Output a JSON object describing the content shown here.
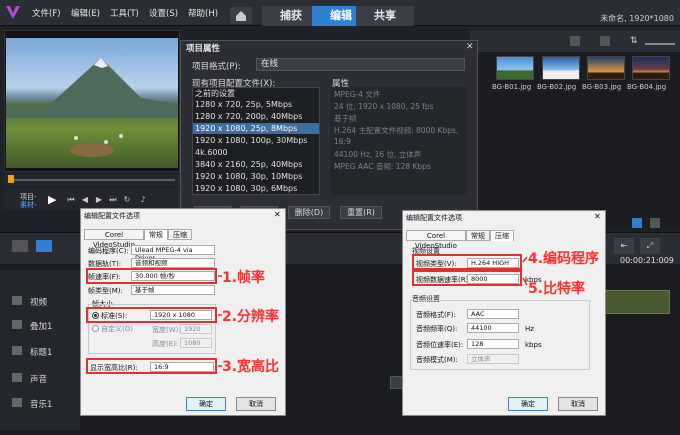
{
  "menu": [
    "文件(F)",
    "编辑(E)",
    "工具(T)",
    "设置(S)",
    "帮助(H)"
  ],
  "tabs": [
    "捕获",
    "编辑",
    "共享"
  ],
  "project_name": "未命名, 1920*1080",
  "player": {
    "label_project": "项目-",
    "label_clip": "素材-"
  },
  "library": {
    "thumbs": [
      "BG-B01.jpg",
      "BG-B02.jpg",
      "BG-B03.jpg",
      "BG-B04.jpg"
    ]
  },
  "timeline": {
    "timecode": "00:00:21:009",
    "tracks": [
      "视频",
      "叠加1",
      "标题1",
      "声音",
      "音乐1"
    ]
  },
  "project_dialog": {
    "title": "项目属性",
    "format_label": "项目格式(P):",
    "format_value": "在线",
    "profiles_label": "现有项目配置文件(X):",
    "props_label": "属性",
    "profiles": [
      "之前的设置",
      "1280 x 720, 25p, 5Mbps",
      "1280 x 720, 200p, 40Mbps",
      "1920 x 1080, 25p, 8Mbps",
      "1920 x 1080, 100p, 30Mbps",
      "4k.6000",
      "3840 x 2160, 25p, 40Mbps",
      "1920 x 1080, 30p, 10Mbps",
      "1920 x 1080, 30p, 6Mbps"
    ],
    "properties": [
      "MPEG-4 文件",
      "24 位, 1920 x 1080, 25 fps",
      "基于帧",
      "H.264 主配置文件视频: 8000 Kbps,",
      "16:9",
      "44100 Hz, 16 位, 立体声",
      "MPEG AAC 音频: 128 Kbps"
    ],
    "buttons": [
      "新建",
      "编辑",
      "删除(D)",
      "重置(R)"
    ]
  },
  "dlg_left": {
    "title": "编辑配置文件选项",
    "tabs": [
      "Corel VideoStudio",
      "常规",
      "压缩"
    ],
    "rows": [
      {
        "label": "编码程序(C):",
        "value": "Ulead MPEG-4 via Driver"
      },
      {
        "label": "数据轨(T):",
        "value": "音频和视频"
      },
      {
        "label": "帧速率(F):",
        "value": "30.000 帧/秒"
      },
      {
        "label": "帧类型(M):",
        "value": "基于帧"
      }
    ],
    "framesize_label": "帧大小",
    "std_label": "标准(S):",
    "std_value": "1920 x 1080",
    "custom_label": "自定义(O)",
    "width_label": "宽度(W):",
    "width_value": "1920",
    "height_label": "高度(E):",
    "height_value": "1080",
    "aspect_label": "显示宽高比(R):",
    "aspect_value": "16:9",
    "ok": "确定",
    "cancel": "取消"
  },
  "dlg_right": {
    "title": "编辑配置文件选项",
    "tabs": [
      "Corel VideoStudio",
      "常规",
      "压缩"
    ],
    "video_group": "视频设置",
    "video_type_label": "视频类型(V):",
    "video_type_value": "H.264 HIGH",
    "bitrate_label": "视频数据速率(R):",
    "bitrate_value": "8000",
    "bitrate_unit": "kbps",
    "audio_group": "音频设置",
    "audio_rows": [
      {
        "label": "音频格式(F):",
        "value": "AAC",
        "unit": ""
      },
      {
        "label": "音频频率(Q):",
        "value": "44100",
        "unit": "Hz"
      },
      {
        "label": "音频位速率(E):",
        "value": "128",
        "unit": "kbps"
      },
      {
        "label": "音频模式(M):",
        "value": "立体声",
        "unit": ""
      }
    ],
    "ok": "确定",
    "cancel": "取消"
  },
  "annotations": [
    "1.帧率",
    "2.分辨率",
    "3.宽高比",
    "4.编码程序",
    "5.比特率"
  ],
  "colors": {
    "accent": "#2f7fd3",
    "annotation": "#e03131"
  }
}
